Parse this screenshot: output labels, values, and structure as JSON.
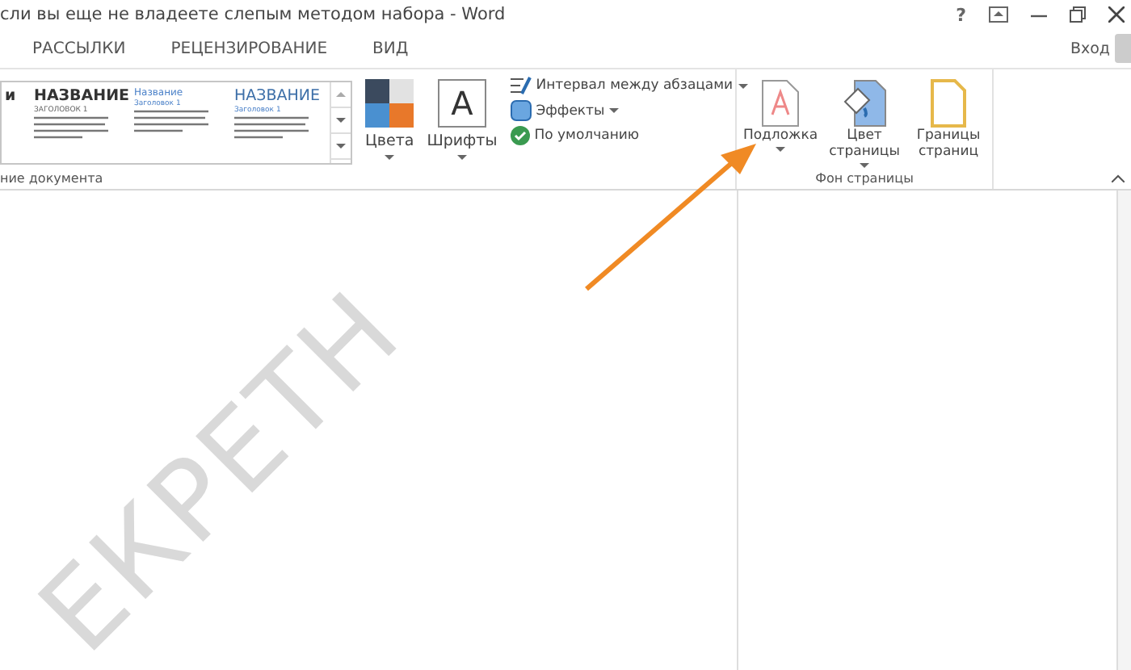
{
  "window": {
    "title": "сли вы еще не владеете слепым методом набора - Word",
    "help": "?"
  },
  "tabs": [
    {
      "label": "РАССЫЛКИ",
      "selected": false
    },
    {
      "label": "РЕЦЕНЗИРОВАНИЕ",
      "selected": false
    },
    {
      "label": "ВИД",
      "selected": false
    }
  ],
  "account": {
    "label": "Вход"
  },
  "ribbon": {
    "style_gallery": [
      {
        "kind": "caps-dark",
        "title": "и"
      },
      {
        "kind": "caps-dark",
        "title": "НАЗВАНИЕ",
        "heading": "ЗАГОЛОВОК 1"
      },
      {
        "kind": "small-blue",
        "title": "Название",
        "heading": "Заголовок 1"
      },
      {
        "kind": "caps-blue",
        "title": "НАЗВАНИЕ",
        "heading": "Заголовок 1"
      }
    ],
    "format_group_label": "ние документа",
    "large_buttons": [
      {
        "kind": "colors",
        "label": "Цвета"
      },
      {
        "kind": "fonts",
        "label": "Шрифты",
        "glyph": "A"
      }
    ],
    "small_commands": [
      {
        "kind": "spacing",
        "label": "Интервал между абзацами",
        "dropdown": true
      },
      {
        "kind": "effects",
        "label": "Эффекты",
        "dropdown": true
      },
      {
        "kind": "default",
        "label": "По умолчанию",
        "dropdown": false
      }
    ],
    "page_background": {
      "label": "Фон страницы",
      "buttons": [
        {
          "kind": "watermark",
          "label": "Подложка",
          "dropdown": true
        },
        {
          "kind": "page-color",
          "label": "Цвет страницы",
          "dropdown": true
        },
        {
          "kind": "borders",
          "label": "Границы страниц",
          "dropdown": false
        }
      ]
    }
  },
  "document": {
    "watermark": "ЕКРЕТН"
  }
}
